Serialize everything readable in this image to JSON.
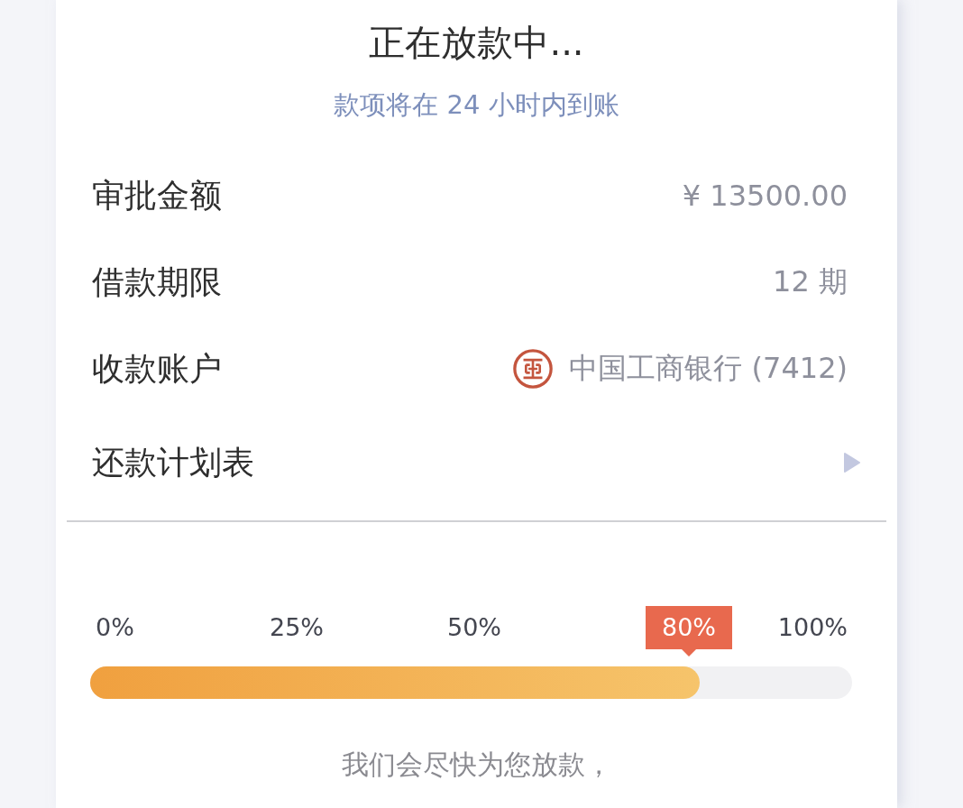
{
  "header": {
    "title": "正在放款中...",
    "subtitle": "款项将在 24 小时内到账"
  },
  "details": [
    {
      "kind": "text",
      "label": "审批金额",
      "value": "¥ 13500.00"
    },
    {
      "kind": "text",
      "label": "借款期限",
      "value": "12 期"
    },
    {
      "kind": "account",
      "label": "收款账户",
      "value": "中国工商银行 (7412)"
    },
    {
      "kind": "link",
      "label": "还款计划表"
    }
  ],
  "progress": {
    "level": 0.8,
    "marks": [
      {
        "label": "0%",
        "selected": false
      },
      {
        "label": "25%",
        "selected": false
      },
      {
        "label": "50%",
        "selected": false
      },
      {
        "label": "80%",
        "selected": true
      },
      {
        "label": "100%",
        "selected": false
      }
    ]
  },
  "footer": {
    "note": "我们会尽快为您放款，"
  }
}
